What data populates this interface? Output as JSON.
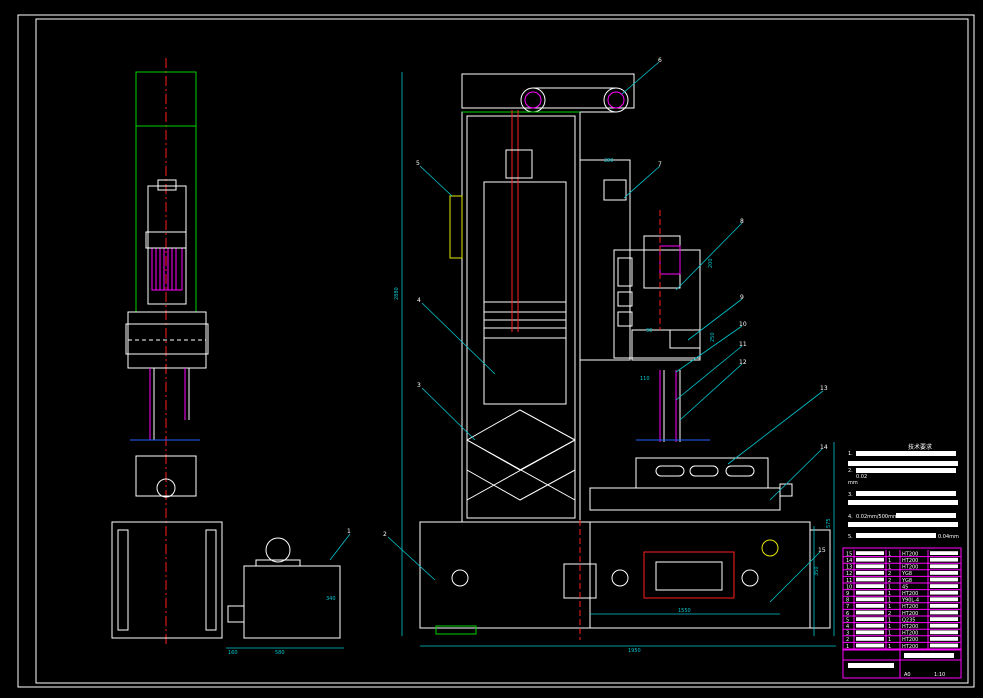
{
  "window": {
    "colors": {
      "background": "#000000",
      "outline": "#ffffff",
      "accent_green": "#00d000",
      "centerline_red": "#ff2020",
      "dimension_cyan": "#00c8d0",
      "motor_magenta": "#ff00ff",
      "hatch_yellow": "#e8e800"
    }
  },
  "balloons": [
    "1",
    "2",
    "3",
    "4",
    "5",
    "6",
    "7",
    "8",
    "9",
    "10",
    "11",
    "12",
    "13",
    "14",
    "15"
  ],
  "dimensions": {
    "side_base_left": "160",
    "side_base_width": "580",
    "side_tank_height": "340",
    "overall_height": "2880",
    "right_height": "575",
    "base_height": "350",
    "top_block": "280",
    "head_height": "200",
    "head_lower": "250",
    "head_small": "90",
    "head_offset": "110",
    "worktable_width": "1550",
    "overall_width": "1950",
    "head_center": "360"
  },
  "tech_requirements": {
    "title": "技术要求",
    "items": [
      "1.",
      "2.",
      "3.",
      "4.",
      "5."
    ],
    "notes": [
      "0.02",
      "mm",
      "0.02mm/500mm",
      "0.04mm"
    ]
  },
  "title_block": {
    "rows": [
      {
        "no": "15",
        "qty": "1",
        "mat": "HT200"
      },
      {
        "no": "14",
        "qty": "1",
        "mat": "HT200"
      },
      {
        "no": "13",
        "qty": "1",
        "mat": "HT200"
      },
      {
        "no": "12",
        "qty": "2",
        "mat": "YG8"
      },
      {
        "no": "11",
        "qty": "2",
        "mat": "YG8"
      },
      {
        "no": "10",
        "qty": "1",
        "mat": "45"
      },
      {
        "no": "9",
        "qty": "1",
        "mat": "HT200"
      },
      {
        "no": "8",
        "qty": "1",
        "mat": "Y90L-4"
      },
      {
        "no": "7",
        "qty": "1",
        "mat": "HT200"
      },
      {
        "no": "6",
        "qty": "2",
        "mat": "HT200"
      },
      {
        "no": "5",
        "qty": "1",
        "mat": "Q235"
      },
      {
        "no": "4",
        "qty": "1",
        "mat": "HT200"
      },
      {
        "no": "3",
        "qty": "1",
        "mat": "HT200"
      },
      {
        "no": "2",
        "qty": "1",
        "mat": "HT200"
      },
      {
        "no": "1",
        "qty": "1",
        "mat": "HT200"
      }
    ],
    "sheet": "A0",
    "scale": "1:10"
  }
}
